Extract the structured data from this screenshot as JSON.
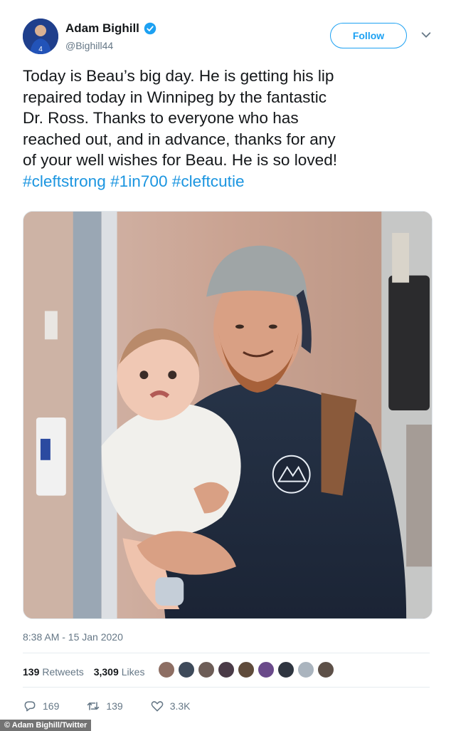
{
  "tweet": {
    "author": {
      "display_name": "Adam Bighill",
      "handle": "@Bighill44",
      "verified": true,
      "verified_color": "#1da1f2"
    },
    "follow_label": "Follow",
    "text_lines": [
      "Today is Beau’s big day. He is getting his lip",
      "repaired today in Winnipeg by the fantastic",
      "Dr. Ross. Thanks to everyone who has",
      "reached out, and in advance, thanks for any",
      "of your well wishes for Beau. He is so loved!"
    ],
    "hashtags": [
      "#cleftstrong",
      "#1in700",
      "#cleftcutie"
    ],
    "hashtag_color": "#1b95e0",
    "timestamp": "8:38 AM - 15 Jan 2020",
    "retweets": {
      "count": "139",
      "label": "Retweets"
    },
    "likes": {
      "count": "3,309",
      "label": "Likes"
    },
    "actions": {
      "reply_count": "169",
      "retweet_count": "139",
      "like_count": "3.3K"
    }
  },
  "icons": [
    "verified-badge-icon",
    "chevron-down-icon",
    "reply-icon",
    "retweet-icon",
    "like-icon"
  ],
  "credit": "© Adam Bighill/Twitter"
}
